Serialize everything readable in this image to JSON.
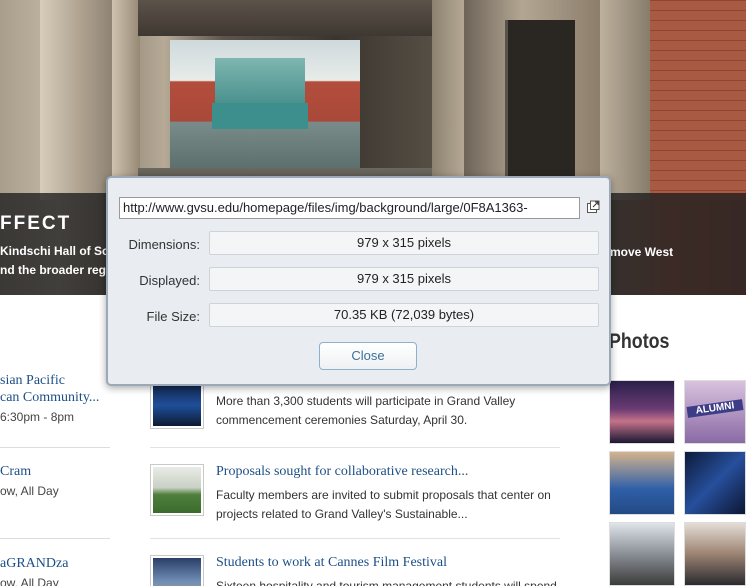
{
  "hero": {
    "title": "FFECT",
    "caption_line1": "Kindschi Hall of Scie",
    "caption_line2": "nd the broader regio",
    "caption_right": "move West"
  },
  "events": [
    {
      "title_line1": "sian Pacific",
      "title_line2": "can Community...",
      "time": "6:30pm - 8pm"
    },
    {
      "title_line1": "Cram",
      "title_line2": "",
      "time": "ow, All Day"
    },
    {
      "title_line1": "aGRANDza",
      "title_line2": "",
      "time": "ow, All Day"
    }
  ],
  "news": [
    {
      "title": "",
      "text": "More than 3,300 students will participate in Grand Valley commencement ceremonies Saturday, April 30."
    },
    {
      "title": "Proposals sought for collaborative research...",
      "text": "Faculty members are invited to submit proposals that center on projects related to Grand Valley's Sustainable..."
    },
    {
      "title": "Students to work at Cannes Film Festival",
      "text": "Sixteen hospitality and tourism management students will spend"
    }
  ],
  "photos": {
    "heading": "Photos",
    "alumni_text": "ALUMNI"
  },
  "dialog": {
    "url": "http://www.gvsu.edu/homepage/files/img/background/large/0F8A1363-",
    "dimensions_label": "Dimensions:",
    "dimensions_value": "979 x 315 pixels",
    "displayed_label": "Displayed:",
    "displayed_value": "979 x 315 pixels",
    "filesize_label": "File Size:",
    "filesize_value": "70.35 KB (72,039 bytes)",
    "close_label": "Close"
  },
  "colors": {
    "link_blue": "#1d4f86",
    "dialog_bg": "#e9ecf0",
    "dialog_border": "#9aa8b8",
    "close_text": "#3d6f99"
  }
}
